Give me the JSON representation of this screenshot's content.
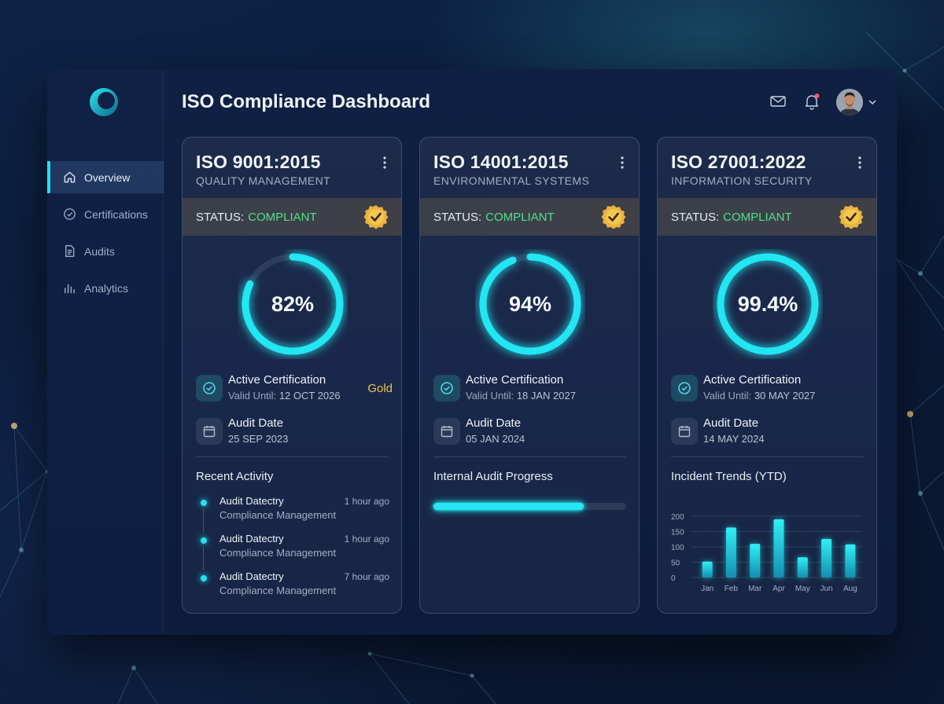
{
  "app": {
    "title": "ISO Compliance Dashboard"
  },
  "sidebar": {
    "items": [
      {
        "label": "Overview",
        "icon": "home-icon",
        "active": true
      },
      {
        "label": "Certifications",
        "icon": "check-circle-icon",
        "active": false
      },
      {
        "label": "Audits",
        "icon": "document-icon",
        "active": false
      },
      {
        "label": "Analytics",
        "icon": "bar-chart-icon",
        "active": false
      }
    ]
  },
  "header": {
    "icons": [
      "mail-icon",
      "bell-icon",
      "avatar",
      "chevron-down-icon"
    ],
    "notification_dot_color": "#ff5a5a"
  },
  "colors": {
    "accent": "#23e1f0",
    "compliant": "#4fe08c",
    "gold": "#f2c14e"
  },
  "cards": [
    {
      "title": "ISO 9001:2015",
      "subtitle": "QUALITY MANAGEMENT",
      "status_label": "STATUS:",
      "status_value": "COMPLIANT",
      "score": "82%",
      "score_value": 82,
      "cert_title": "Active Certification",
      "cert_valid_label": "Valid Until:",
      "cert_valid_date": "12 OCT 2026",
      "cert_tier": "Gold",
      "audit_title": "Audit Date",
      "audit_date": "25 SEP 2023",
      "section_title": "Recent Activity",
      "activity": [
        {
          "title": "Audit Datectry",
          "sub": "Compliance Management",
          "time": "1 hour ago"
        },
        {
          "title": "Audit Datectry",
          "sub": "Compliance Management",
          "time": "1 hour ago"
        },
        {
          "title": "Audit Datectry",
          "sub": "Compliance Management",
          "time": "7 hour ago"
        }
      ]
    },
    {
      "title": "ISO 14001:2015",
      "subtitle": "ENVIRONMENTAL SYSTEMS",
      "status_label": "STATUS:",
      "status_value": "COMPLIANT",
      "score": "94%",
      "score_value": 94,
      "cert_title": "Active Certification",
      "cert_valid_label": "Valid Until:",
      "cert_valid_date": "18 JAN 2027",
      "audit_title": "Audit Date",
      "audit_date": "05 JAN 2024",
      "section_title": "Internal Audit Progress",
      "progress": 0.78
    },
    {
      "title": "ISO 27001:2022",
      "subtitle": "INFORMATION SECURITY",
      "status_label": "STATUS:",
      "status_value": "COMPLIANT",
      "score": "99.4%",
      "score_value": 99.4,
      "cert_title": "Active Certification",
      "cert_valid_label": "Valid Until:",
      "cert_valid_date": "30 MAY 2027",
      "audit_title": "Audit Date",
      "audit_date": "14 MAY 2024",
      "section_title": "Incident Trends (YTD)"
    }
  ],
  "chart_data": {
    "type": "bar",
    "title": "Incident Trends (YTD)",
    "categories": [
      "Jan",
      "Feb",
      "Mar",
      "Apr",
      "May",
      "Jun",
      "Aug"
    ],
    "values": [
      52,
      163,
      110,
      190,
      66,
      126,
      108
    ],
    "ylim": [
      0,
      200
    ],
    "yticks": [
      0,
      50,
      100,
      150,
      200
    ],
    "grid": true
  }
}
